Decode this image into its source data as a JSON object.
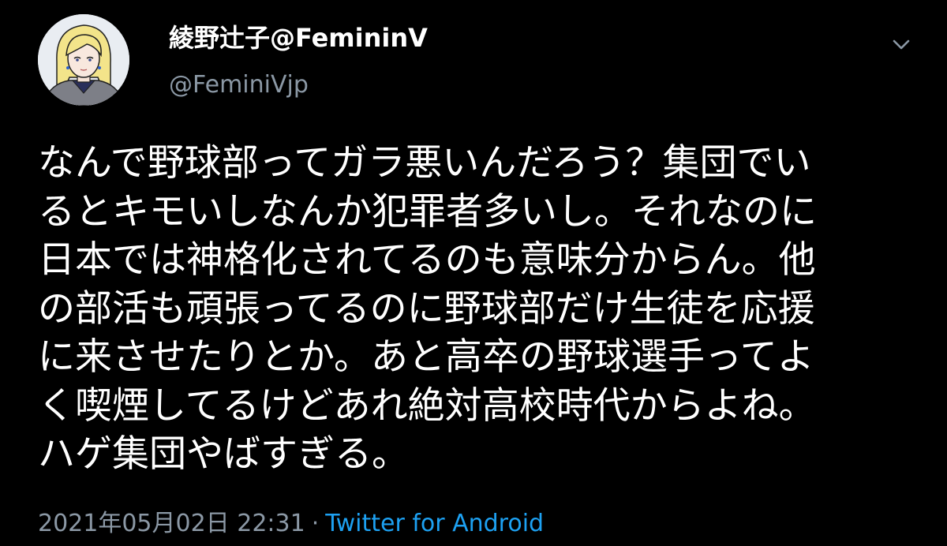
{
  "tweet": {
    "display_name": "綾野辻子@FemininV",
    "handle": "@FeminiVjp",
    "text": "なんで野球部ってガラ悪いんだろう？集団でい\nるとキモいしなんか犯罪者多いし。それなのに\n日本では神格化されてるのも意味分からん。他\nの部活も頑張ってるのに野球部だけ生徒を応援\nに来させたりとか。あと高卒の野球選手ってよ\nく喫煙してるけどあれ絶対高校時代からよね。\nハゲ集団やばすぎる。",
    "timestamp": "2021年05月02日 22:31",
    "separator": "·",
    "source": "Twitter for Android"
  },
  "icons": {
    "avatar": "profile-avatar-illustration",
    "menu": "chevron-down-icon"
  },
  "colors": {
    "background": "#000000",
    "primary_text": "#ffffff",
    "secondary_text": "#8b98a5",
    "link": "#1da1f2"
  }
}
